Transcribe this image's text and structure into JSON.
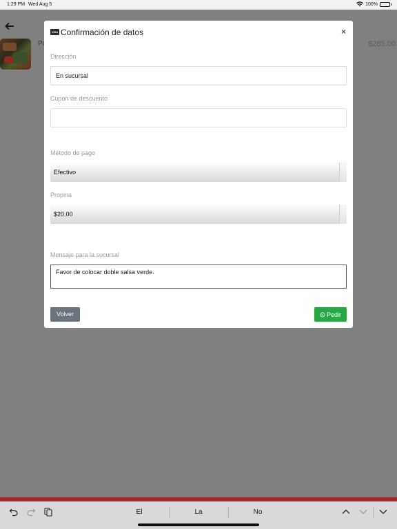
{
  "status_bar": {
    "time": "1:29 PM",
    "date": "Wed Aug 5",
    "battery": "100%"
  },
  "background": {
    "product_name_partial": "Po",
    "price": "$285.00"
  },
  "modal": {
    "title": "Confirmación de datos",
    "card_icon_text": "VISA",
    "close_label": "×",
    "fields": {
      "address_label": "Dirección",
      "address_value": "En sucursal",
      "coupon_label": "Cupon de descuento",
      "coupon_value": "",
      "payment_label": "Método de pago",
      "payment_value": "Efectivo",
      "tip_label": "Propina",
      "tip_value": "$20.00",
      "message_label": "Mensaje para la sucursal",
      "message_value": "Favor de colocar doble salsa verde."
    },
    "buttons": {
      "back": "Volver",
      "order": "Pedir"
    }
  },
  "keyboard_bar": {
    "suggestions": [
      "El",
      "La",
      "No"
    ]
  },
  "colors": {
    "overlay": "#808080",
    "back_button": "#6c757d",
    "order_button": "#28a745",
    "bottom_band": "#a5282d"
  }
}
